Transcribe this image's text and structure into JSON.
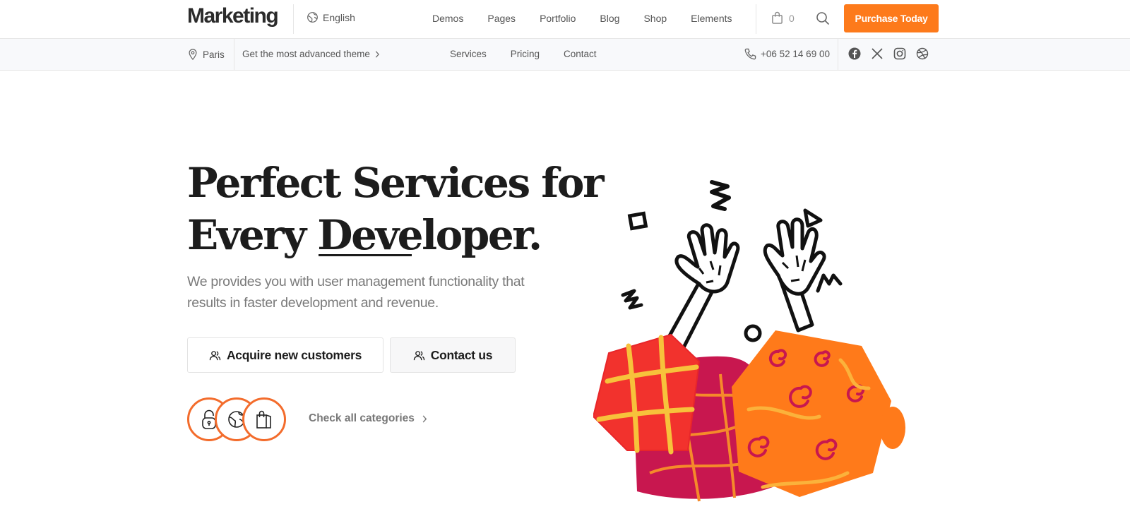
{
  "header": {
    "logo": "Marketing",
    "language": "English",
    "nav": [
      "Demos",
      "Pages",
      "Portfolio",
      "Blog",
      "Shop",
      "Elements"
    ],
    "cart_count": "0",
    "cta": "Purchase Today"
  },
  "subheader": {
    "location": "Paris",
    "promo": "Get the most advanced theme",
    "nav": [
      "Services",
      "Pricing",
      "Contact"
    ],
    "phone": "+06 52 14 69 00",
    "socials": [
      "facebook-icon",
      "x-icon",
      "instagram-icon",
      "dribbble-icon"
    ]
  },
  "hero": {
    "headline_line1": "Perfect Services for",
    "headline_line2_a": "Every ",
    "headline_line2_b": "Developer.",
    "lead": "We provides you with user management functionality that results in faster development and revenue.",
    "btn_primary": "Acquire new customers",
    "btn_secondary": "Contact us",
    "category_icons": [
      "lock-icon",
      "globe-icon",
      "shopping-bag-icon"
    ],
    "categories_link": "Check all categories"
  },
  "colors": {
    "accent": "#fd7a1b",
    "ring": "#f36c2c",
    "text_dark": "#1c1c1c",
    "text_muted": "#7a7a7a"
  }
}
